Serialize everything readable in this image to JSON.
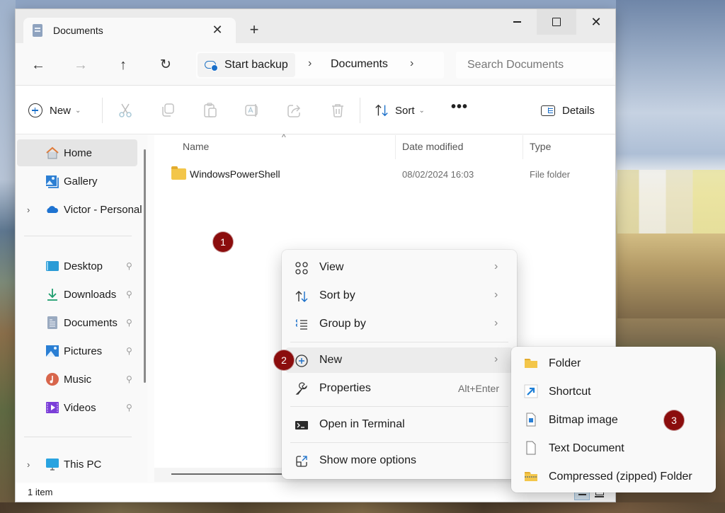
{
  "window": {
    "tab_title": "Documents",
    "tab_close": "✕",
    "tab_add": "+",
    "minimize": "",
    "maximize": "",
    "close": "✕"
  },
  "nav": {
    "back": "←",
    "forward": "→",
    "up": "↑",
    "refresh": "↻",
    "breadcrumb": [
      {
        "label": "Start backup",
        "icon": "cloud-backup-icon"
      },
      {
        "label": "Documents"
      }
    ],
    "separator": "›",
    "search_placeholder": "Search Documents"
  },
  "toolbar": {
    "new_label": "New",
    "caret": "⌄",
    "actions": [
      "cut",
      "copy",
      "paste",
      "rename",
      "share",
      "delete"
    ],
    "sort_label": "Sort",
    "more": "•••",
    "details_label": "Details"
  },
  "sidebar": {
    "items": [
      {
        "label": "Home",
        "icon": "home-icon",
        "active": true
      },
      {
        "label": "Gallery",
        "icon": "gallery-icon"
      },
      {
        "label": "Victor - Personal",
        "icon": "onedrive-icon",
        "expandable": true
      },
      {
        "label": "Desktop",
        "icon": "desktop-icon",
        "pinned": true
      },
      {
        "label": "Downloads",
        "icon": "downloads-icon",
        "pinned": true
      },
      {
        "label": "Documents",
        "icon": "documents-icon",
        "pinned": true
      },
      {
        "label": "Pictures",
        "icon": "pictures-icon",
        "pinned": true
      },
      {
        "label": "Music",
        "icon": "music-icon",
        "pinned": true
      },
      {
        "label": "Videos",
        "icon": "videos-icon",
        "pinned": true
      },
      {
        "label": "This PC",
        "icon": "this-pc-icon",
        "expandable": true
      }
    ],
    "expand_glyph": "›",
    "pin_glyph": "📌"
  },
  "content": {
    "columns": [
      "Name",
      "Date modified",
      "Type"
    ],
    "sort_indicator": "^",
    "files": [
      {
        "name": "WindowsPowerShell",
        "date": "08/02/2024 16:03",
        "type": "File folder"
      }
    ]
  },
  "status": {
    "item_count": "1 item"
  },
  "context_menu": {
    "items": [
      {
        "label": "View",
        "icon": "view-icon",
        "submenu": true
      },
      {
        "label": "Sort by",
        "icon": "sort-icon",
        "submenu": true
      },
      {
        "label": "Group by",
        "icon": "group-icon",
        "submenu": true
      },
      {
        "label": "New",
        "icon": "new-icon",
        "submenu": true,
        "hover": true
      },
      {
        "label": "Properties",
        "icon": "properties-icon",
        "shortcut": "Alt+Enter"
      },
      {
        "label": "Open in Terminal",
        "icon": "terminal-icon"
      },
      {
        "label": "Show more options",
        "icon": "more-options-icon"
      }
    ],
    "arrow": "›"
  },
  "new_submenu": {
    "items": [
      {
        "label": "Folder",
        "icon": "folder-icon"
      },
      {
        "label": "Shortcut",
        "icon": "shortcut-icon"
      },
      {
        "label": "Bitmap image",
        "icon": "bitmap-icon"
      },
      {
        "label": "Text Document",
        "icon": "text-document-icon"
      },
      {
        "label": "Compressed (zipped) Folder",
        "icon": "zip-folder-icon"
      }
    ]
  },
  "annotations": [
    "1",
    "2",
    "3"
  ],
  "colors": {
    "accent": "#1a6fc9",
    "badge": "#8b0d0d",
    "folder": "#f3c64a"
  }
}
